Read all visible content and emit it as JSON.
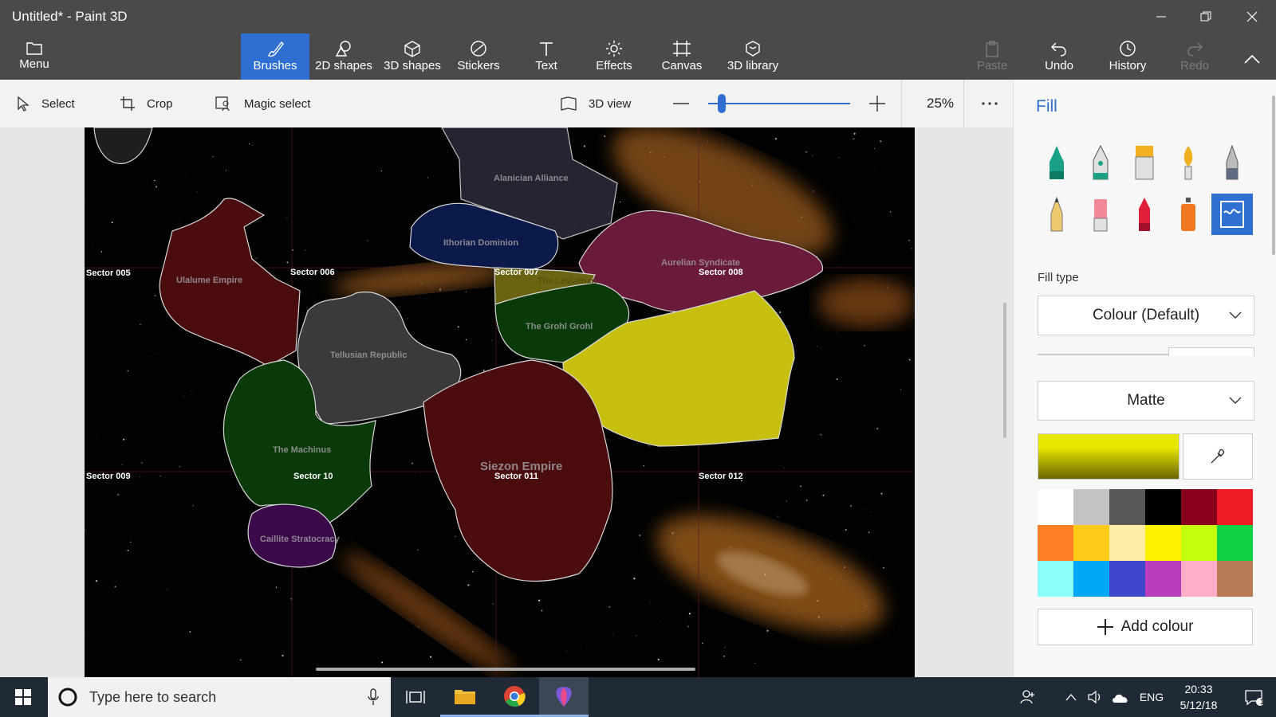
{
  "window": {
    "title": "Untitled* - Paint 3D"
  },
  "ribbon": {
    "menu_label": "Menu",
    "tools": [
      {
        "label": "Brushes",
        "icon": "brush-icon"
      },
      {
        "label": "2D shapes",
        "icon": "shapes-2d-icon"
      },
      {
        "label": "3D shapes",
        "icon": "cube-icon"
      },
      {
        "label": "Stickers",
        "icon": "sticker-icon"
      },
      {
        "label": "Text",
        "icon": "text-icon"
      },
      {
        "label": "Effects",
        "icon": "sun-icon"
      },
      {
        "label": "Canvas",
        "icon": "canvas-icon"
      },
      {
        "label": "3D library",
        "icon": "library-icon"
      }
    ],
    "actions": {
      "paste": "Paste",
      "undo": "Undo",
      "history": "History",
      "redo": "Redo"
    }
  },
  "toolbar": {
    "select": "Select",
    "crop": "Crop",
    "magic_select": "Magic select",
    "view_3d": "3D view",
    "zoom_percent": "25%",
    "zoom_level": 0.07
  },
  "canvas": {
    "sectors": [
      "Sector 005",
      "Sector 006",
      "Sector 007",
      "Sector 008",
      "Sector 009",
      "Sector 10",
      "Sector 011",
      "Sector 012"
    ],
    "regions": [
      "Alanician Alliance",
      "Ithorian Dominion",
      "Ulalume Empire",
      "Aurelian Syndicate",
      "The Leviathan",
      "The Grohl Grohl",
      "Tellusian Republic",
      "The Machinus",
      "Siezon Empire",
      "Caillite Stratocracy"
    ]
  },
  "panel": {
    "title": "Fill",
    "fill_type_label": "Fill type",
    "fill_type_value": "Colour (Default)",
    "finish_value": "Matte",
    "current_colour": "#e6e600",
    "add_colour": "Add colour",
    "palette": [
      "#ffffff",
      "#c3c3c3",
      "#585858",
      "#000000",
      "#88001b",
      "#ec1c24",
      "#ff7f27",
      "#ffca18",
      "#fdeca6",
      "#fff200",
      "#c4ff0e",
      "#0ed145",
      "#8cfffb",
      "#00a8f3",
      "#3f48cc",
      "#b83dba",
      "#ffaec8",
      "#b97a56"
    ]
  },
  "taskbar": {
    "search_placeholder": "Type here to search",
    "language": "ENG",
    "time": "20:33",
    "date": "5/12/18",
    "notification_count": "1"
  }
}
